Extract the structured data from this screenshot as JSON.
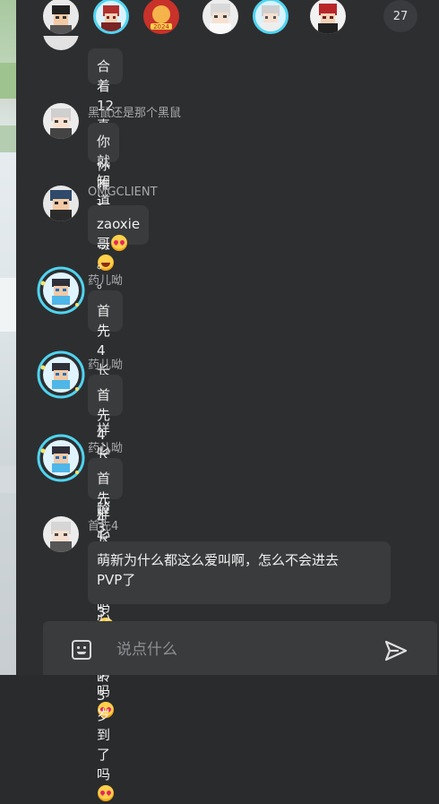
{
  "top_bar": {
    "avatars": [
      "user-avatar-1",
      "user-avatar-2",
      "user-avatar-3",
      "user-avatar-4",
      "user-avatar-5",
      "user-avatar-6"
    ],
    "member_count": "27"
  },
  "messages": [
    {
      "sender": "",
      "text": "合着12真成你唯一了呗",
      "suffix": "。",
      "emoji": "rolling-laughing-emoji"
    },
    {
      "sender": "黑鼠还是那个黑鼠",
      "text": "你就知道咧",
      "suffix": "",
      "emoji": ""
    },
    {
      "sender": "OMGCLIENT",
      "text": "zaoxie哥",
      "suffix": "。",
      "emoji": "heart-eyes-emoji"
    },
    {
      "sender": "药儿呦",
      "text": "首先4长得b样心里年龄3岁到了吗",
      "suffix": "",
      "emoji": "heart-eyes-emoji"
    },
    {
      "sender": "药儿呦",
      "text": "首先4长得b样心里年龄3岁到了吗",
      "suffix": "",
      "emoji": "heart-eyes-emoji"
    },
    {
      "sender": "药儿呦",
      "text": "首先4长得b样心里年龄3岁到了吗",
      "suffix": "",
      "emoji": "heart-eyes-emoji"
    },
    {
      "sender": "首先4",
      "text_line1": "萌新为什么都这么爱叫啊，怎么不会进去",
      "text_line2": "PVP了",
      "emoji": ""
    }
  ],
  "input": {
    "placeholder": "说点什么",
    "value": ""
  },
  "colors": {
    "panel_bg": "#2d2e30",
    "bubble_bg": "#3a3b3d",
    "name_color": "#a9aaad",
    "ring_cyan": "#4fd4f0"
  }
}
